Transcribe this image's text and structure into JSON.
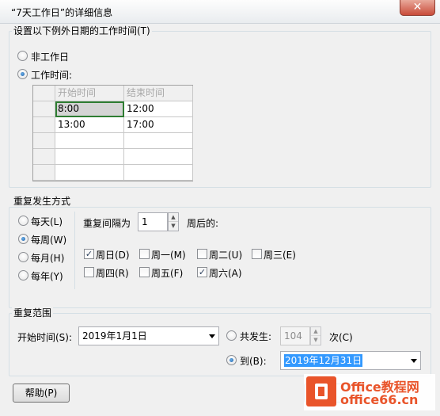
{
  "window": {
    "title": "“7天工作日”的详细信息",
    "close": "✕"
  },
  "exception_group": {
    "label": "设置以下例外日期的工作时间(T)",
    "non_working": "非工作日",
    "working_time": "工作时间:",
    "selected": "working_time",
    "columns": [
      "开始时间",
      "结束时间"
    ],
    "rows": [
      {
        "start": "8:00",
        "end": "12:00"
      },
      {
        "start": "13:00",
        "end": "17:00"
      },
      {
        "start": "",
        "end": ""
      },
      {
        "start": "",
        "end": ""
      },
      {
        "start": "",
        "end": ""
      }
    ]
  },
  "recurrence": {
    "label": "重复发生方式",
    "options": [
      "每天(L)",
      "每周(W)",
      "每月(H)",
      "每年(Y)"
    ],
    "selected": "每周(W)",
    "interval_label": "重复间隔为",
    "interval_value": "1",
    "interval_suffix": "周后的:",
    "days": [
      {
        "label": "周日(D)",
        "checked": true
      },
      {
        "label": "周一(M)",
        "checked": false
      },
      {
        "label": "周二(U)",
        "checked": false
      },
      {
        "label": "周三(E)",
        "checked": false
      },
      {
        "label": "周四(R)",
        "checked": false
      },
      {
        "label": "周五(F)",
        "checked": false
      },
      {
        "label": "周六(A)",
        "checked": true
      }
    ]
  },
  "range": {
    "label": "重复范围",
    "start_label": "开始时间(S):",
    "start_value": "2019年1月1日",
    "occur_label": "共发生:",
    "occur_value": "104",
    "occur_suffix": "次(C)",
    "to_label": "到(B):",
    "to_value": "2019年12月31日",
    "selected": "to"
  },
  "footer": {
    "help": "帮助(P)"
  },
  "watermark": {
    "line1": "Office教程网",
    "line2": "office66.cn"
  }
}
